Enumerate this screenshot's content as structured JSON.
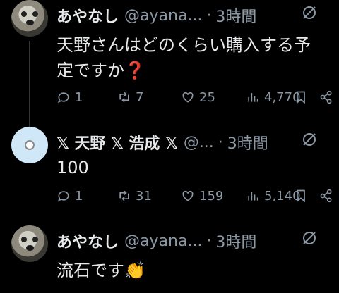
{
  "tweets": [
    {
      "name": "あやなし",
      "handle": "@ayana...",
      "time": "3時間",
      "text_lines": [
        "天野さんはどのくらい購入する予",
        "定ですか❓"
      ],
      "replies": "1",
      "retweets": "7",
      "likes": "25",
      "views": "4,770"
    },
    {
      "name": "𝕏 天野 𝕏 浩成 𝕏",
      "handle": "@...",
      "time": "3時間",
      "text_lines": [
        "100"
      ],
      "replies": "1",
      "retweets": "31",
      "likes": "159",
      "views": "5,140"
    },
    {
      "name": "あやなし",
      "handle": "@ayana...",
      "time": "3時間",
      "text_lines": [
        "流石です👏"
      ]
    }
  ],
  "separator": "·",
  "colors": {
    "background": "#000000",
    "text": "#e7e9ea",
    "muted": "#8b98a5",
    "line": "#333639"
  },
  "icons": [
    "reply-icon",
    "retweet-icon",
    "like-icon",
    "views-icon",
    "bookmark-icon",
    "share-icon",
    "mute-icon"
  ]
}
